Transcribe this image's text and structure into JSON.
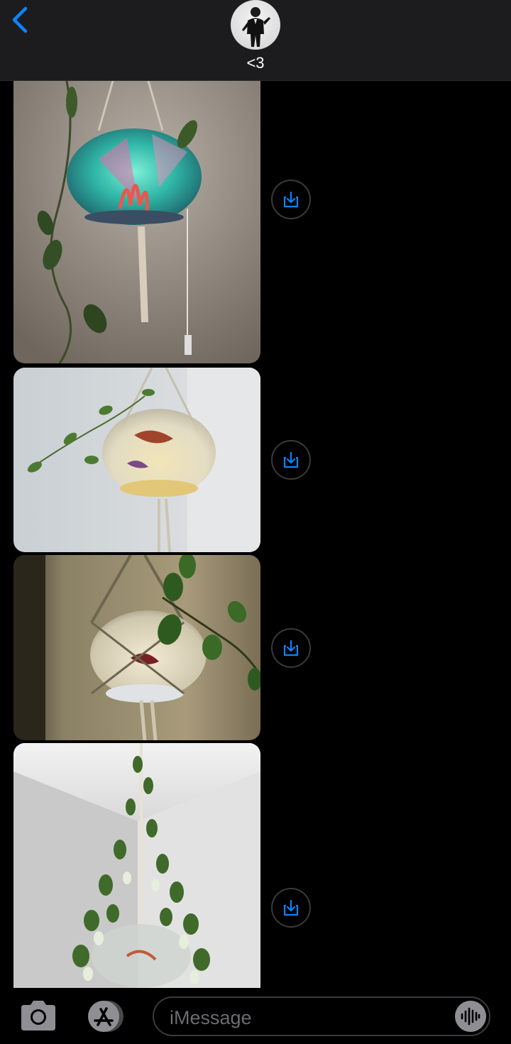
{
  "header": {
    "contact_name": "<3",
    "back_icon": "chevron-left-icon",
    "accent_color": "#0a84ff"
  },
  "messages": [
    {
      "type": "photo",
      "icon": "download-icon"
    },
    {
      "type": "photo",
      "icon": "download-icon"
    },
    {
      "type": "photo",
      "icon": "download-icon"
    },
    {
      "type": "photo",
      "icon": "download-icon"
    }
  ],
  "composer": {
    "placeholder": "iMessage",
    "camera_icon": "camera-icon",
    "apps_icon": "app-store-icon",
    "audio_icon": "audio-waveform-icon"
  }
}
